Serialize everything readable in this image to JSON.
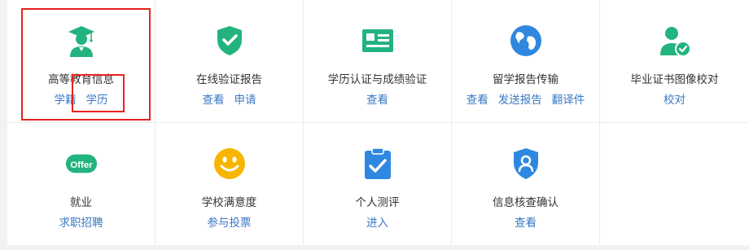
{
  "services": [
    {
      "title": "高等教育信息",
      "icon": "graduate-student-icon",
      "links": [
        "学籍",
        "学历"
      ]
    },
    {
      "title": "在线验证报告",
      "icon": "shield-check-icon",
      "links": [
        "查看",
        "申请"
      ]
    },
    {
      "title": "学历认证与成绩验证",
      "icon": "id-card-icon",
      "links": [
        "查看"
      ]
    },
    {
      "title": "留学报告传输",
      "icon": "globe-icon",
      "links": [
        "查看",
        "发送报告",
        "翻译件"
      ]
    },
    {
      "title": "毕业证书图像校对",
      "icon": "user-verified-icon",
      "links": [
        "校对"
      ]
    },
    {
      "title": "就业",
      "icon": "offer-badge-icon",
      "icon_text": "Offer",
      "links": [
        "求职招聘"
      ]
    },
    {
      "title": "学校满意度",
      "icon": "smiley-face-icon",
      "links": [
        "参与投票"
      ]
    },
    {
      "title": "个人测评",
      "icon": "clipboard-check-icon",
      "links": [
        "进入"
      ]
    },
    {
      "title": "信息核查确认",
      "icon": "user-shield-icon",
      "links": [
        "查看"
      ]
    }
  ],
  "colors": {
    "green": "#23b37f",
    "blue": "#2f88e0",
    "yellow": "#f7b500",
    "link": "#3a78c3",
    "highlight": "#e8231f"
  }
}
